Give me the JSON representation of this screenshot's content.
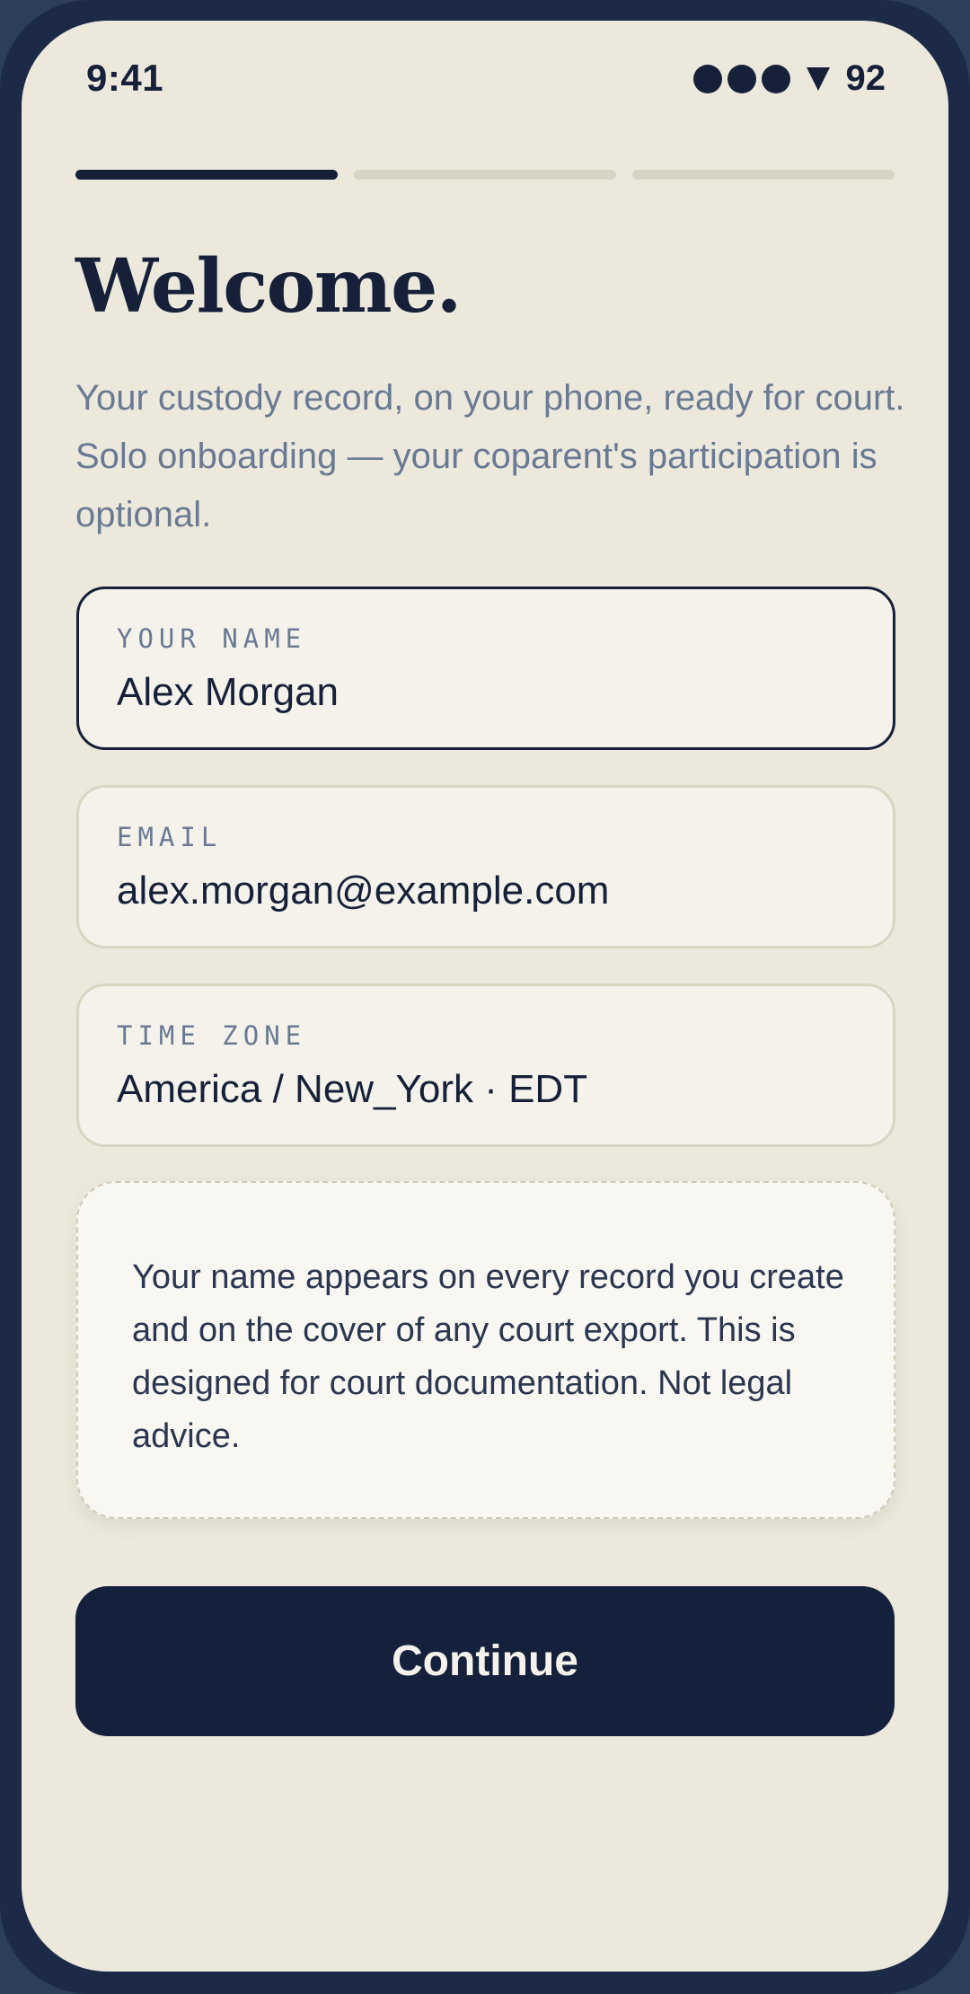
{
  "status_bar": {
    "time": "9:41",
    "battery": "92"
  },
  "progress": {
    "total_steps": 3,
    "current_step": 1
  },
  "header": {
    "title": "Welcome.",
    "subtitle": "Your custody record, on your phone, ready for court. Solo onboarding — your coparent's participation is optional."
  },
  "form": {
    "name": {
      "label": "YOUR NAME",
      "value": "Alex Morgan"
    },
    "email": {
      "label": "EMAIL",
      "value": "alex.morgan@example.com"
    },
    "timezone": {
      "label": "TIME ZONE",
      "value": "America / New_York · EDT"
    }
  },
  "notice": {
    "text": "Your name appears on every record you create and on the cover of any court export. This is designed for court documentation. Not legal advice."
  },
  "actions": {
    "continue_label": "Continue"
  },
  "colors": {
    "frame": "#1c2a47",
    "background": "#ece8dc",
    "primary": "#15203c",
    "muted_text": "#6a7a93",
    "progress_inactive": "#d8d4c5"
  }
}
